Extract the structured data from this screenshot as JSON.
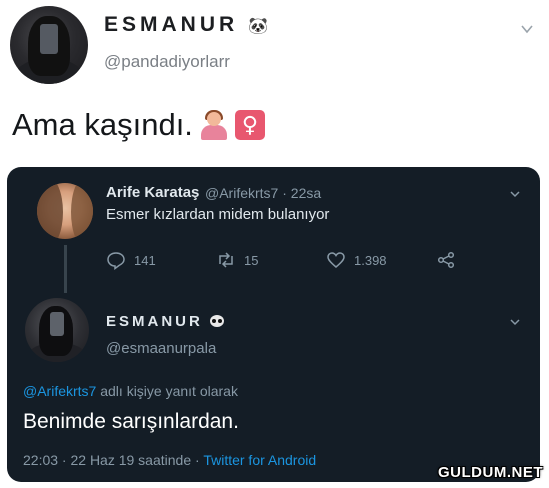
{
  "outer_tweet": {
    "display_name": "ESMANUR",
    "name_emoji": "🐼",
    "handle": "@pandadiyorlarr",
    "text": "Ama kaşındı.",
    "emojis": [
      "woman-shrugging-icon",
      "female-sign-icon"
    ],
    "female_sign": "♀"
  },
  "quoted_tweet": {
    "display_name": "Arife Karataş",
    "handle": "@Arifekrts7 · 22sa",
    "text": "Esmer kızlardan midem bulanıyor",
    "replies": "141",
    "retweets": "15",
    "likes": "1.398"
  },
  "reply_tweet": {
    "display_name": "ESMANUR",
    "handle": "@esmaanurpala",
    "reply_to_mention": "@Arifekrts7",
    "reply_to_suffix": " adlı kişiye yanıt olarak",
    "text": "Benimde sarışınlardan.",
    "meta_time": "22:03 · 22 Haz 19 saatinde · ",
    "meta_source": "Twitter for Android"
  },
  "watermark": "GULDUM.NET",
  "colors": {
    "dark_bg": "#141d26",
    "link_blue": "#1b95e0",
    "muted": "#8899a6"
  }
}
